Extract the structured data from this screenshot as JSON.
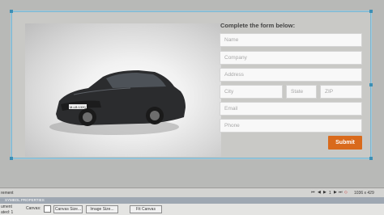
{
  "form": {
    "title": "Complete the form below:",
    "name_placeholder": "Name",
    "company_placeholder": "Company",
    "address_placeholder": "Address",
    "city_placeholder": "City",
    "state_placeholder": "State",
    "zip_placeholder": "ZIP",
    "email_placeholder": "Email",
    "phone_placeholder": "Phone",
    "submit_label": "Submit"
  },
  "car": {
    "plate": "M-LB 1320"
  },
  "statusbar": {
    "left_label": "rement",
    "page_indicator": "1",
    "dimensions": "1036 x 429"
  },
  "panel": {
    "title": "SYMBOL PROPERTIES",
    "side_label_1": "ument",
    "side_label_2": "ated: 1",
    "canvas_label": "Canvas:",
    "canvas_size_button": "Canvas Size...",
    "image_size_button": "Image Size...",
    "fit_canvas_button": "Fit Canvas"
  },
  "colors": {
    "accent_orange": "#d96a1c",
    "selection_blue": "#7fb6cf"
  }
}
